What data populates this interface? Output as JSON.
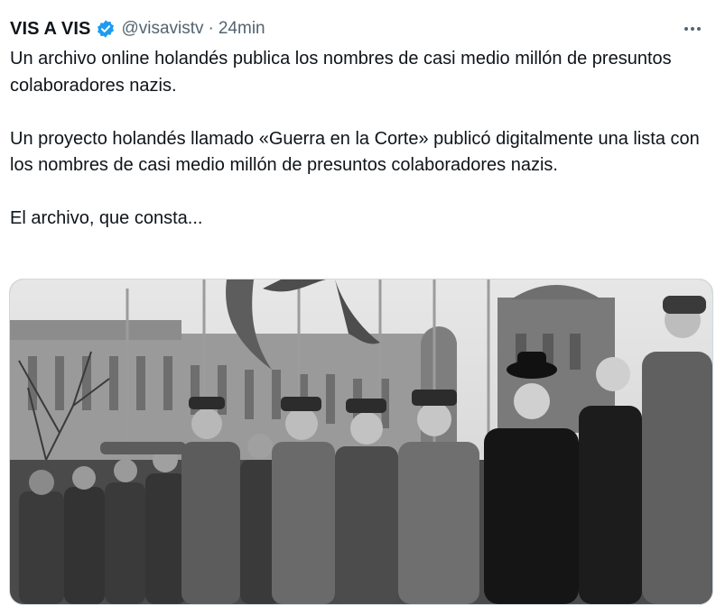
{
  "tweet": {
    "display_name": "VIS A VIS",
    "handle": "@visavistv",
    "separator": "·",
    "time": "24min",
    "verified_icon": "verified-badge-icon",
    "more_icon": "more-dots-icon",
    "paragraphs": [
      "Un archivo online holandés publica los nombres de casi medio millón de presuntos colaboradores nazis.",
      "Un proyecto holandés llamado «Guerra en la Corte» publicó digitalmente una lista con los nombres de casi medio millón de presuntos colaboradores nazis.",
      "El archivo, que consta..."
    ]
  },
  "colors": {
    "text": "#0f1419",
    "secondary": "#536471",
    "verified": "#1d9bf0",
    "border": "#cfd9de"
  }
}
